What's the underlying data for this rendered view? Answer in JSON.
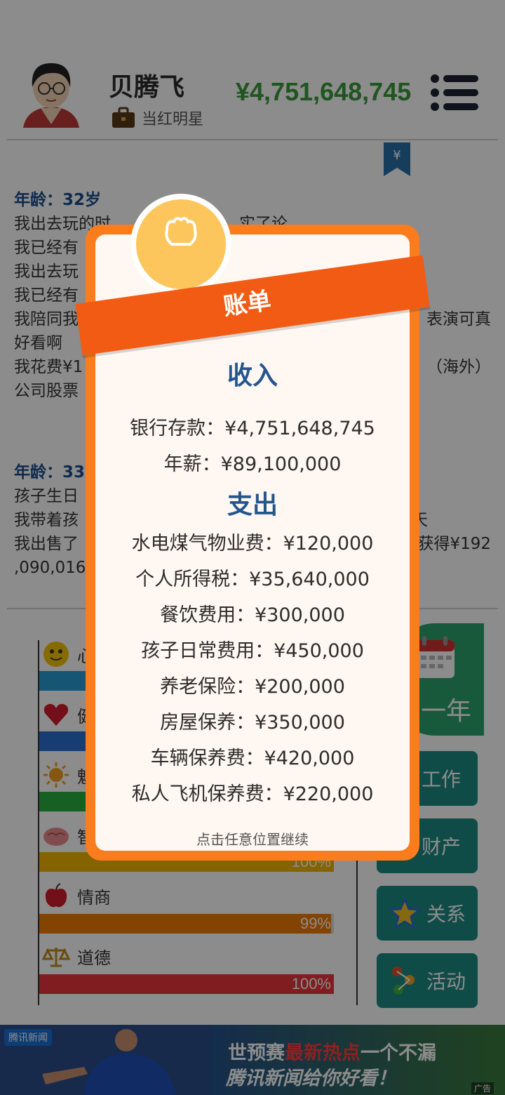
{
  "header": {
    "name": "贝腾飞",
    "job": "当红明星",
    "money": "¥4,751,648,745",
    "bookmark_symbol": "¥"
  },
  "log": [
    {
      "age": "年龄：32岁",
      "lines": [
        "我出去玩的时",
        "我已经有",
        "我出去玩",
        "我已经有",
        "我陪同我",
        "好看啊",
        "我花费¥1",
        "公司股票"
      ]
    },
    {
      "age": "年龄：33",
      "lines": [
        "孩子生日",
        "我带着孩",
        "我出售了",
        ",090,016"
      ]
    }
  ],
  "log_right_fragments": {
    "line_a": "实了论",
    "line_b": "表演可真",
    "line_c": "（海外）",
    "line_d": "天",
    "line_e": "获得¥192"
  },
  "stats": [
    {
      "label": "心",
      "color": "#2a9bd6",
      "value": 100,
      "pct": ""
    },
    {
      "label": "健",
      "color": "#2a6fd0",
      "value": 100,
      "pct": ""
    },
    {
      "label": "魅",
      "color": "#2bb043",
      "value": 100,
      "pct": ""
    },
    {
      "label": "智",
      "color": "#f2b400",
      "value": 100,
      "pct": "100%"
    },
    {
      "label": "情商",
      "color": "#f07a00",
      "value": 99,
      "pct": "99%"
    },
    {
      "label": "道德",
      "color": "#e8353b",
      "value": 100,
      "pct": "100%"
    }
  ],
  "side_buttons": {
    "next_year": "一年",
    "work": "工作",
    "property": "财产",
    "relations": "关系",
    "activity": "活动"
  },
  "ad": {
    "brand": "腾讯新闻",
    "line1_prefix": "世预赛",
    "line1_hot": "最新热点",
    "line1_suffix": "一个不漏",
    "line2": "腾讯新闻给你好看！",
    "badge": "广告"
  },
  "dialog": {
    "banner": "账单",
    "income_title": "收入",
    "income": [
      "银行存款：¥4,751,648,745",
      "年薪：¥89,100,000"
    ],
    "expense_title": "支出",
    "expenses": [
      "水电煤气物业费：¥120,000",
      "个人所得税：¥35,640,000",
      "餐饮费用：¥300,000",
      "孩子日常费用：¥450,000",
      "养老保险：¥200,000",
      "房屋保养：¥350,000",
      "车辆保养费：¥420,000",
      "私人飞机保养费：¥220,000"
    ],
    "hint": "点击任意位置继续"
  }
}
